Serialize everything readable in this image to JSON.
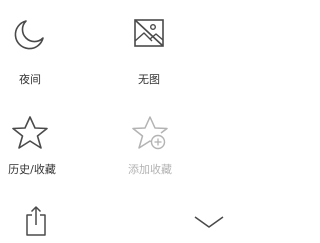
{
  "menu": {
    "items": [
      {
        "id": "night",
        "label": "夜间",
        "icon": "moon-icon",
        "enabled": true
      },
      {
        "id": "no_image",
        "label": "无图",
        "icon": "no-image-icon",
        "enabled": true
      },
      {
        "id": "history_favorites",
        "label": "历史/收藏",
        "icon": "star-icon",
        "enabled": true
      },
      {
        "id": "add_favorite",
        "label": "添加收藏",
        "icon": "star-add-icon",
        "enabled": false
      }
    ],
    "share_icon": "share-icon",
    "collapse_icon": "chevron-down-icon"
  },
  "colors": {
    "icon": "#4a4a4a",
    "label": "#333333",
    "disabled": "#b3b3b3",
    "background": "#ffffff"
  }
}
